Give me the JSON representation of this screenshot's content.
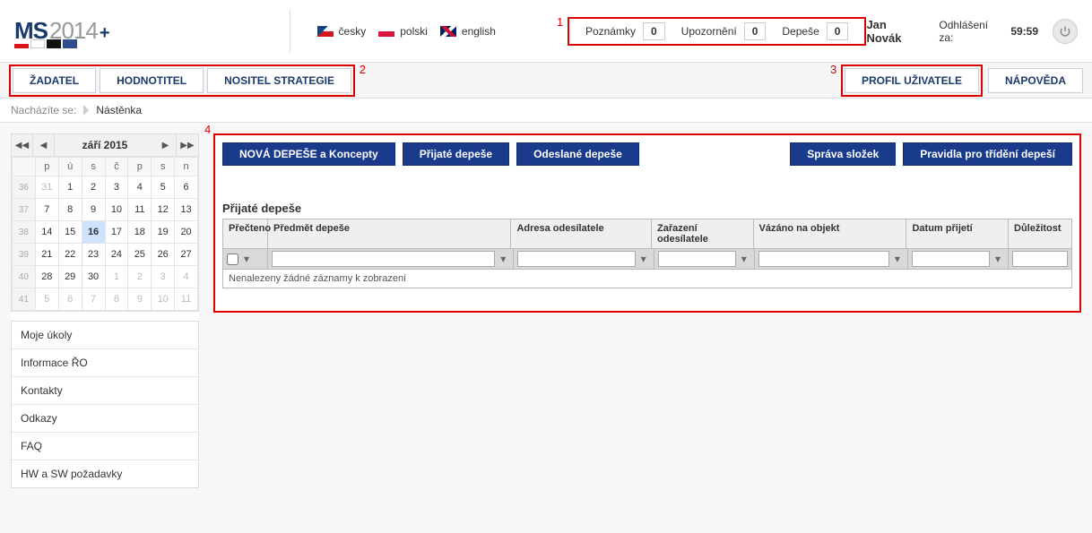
{
  "annotations": {
    "a1": "1",
    "a2": "2",
    "a3": "3",
    "a4": "4"
  },
  "topbar": {
    "logo_ms": "MS",
    "logo_year": "2014",
    "logo_plus": "+",
    "languages": {
      "cz": "česky",
      "pl": "polski",
      "en": "english"
    },
    "counters": {
      "notes_label": "Poznámky",
      "notes_value": "0",
      "alerts_label": "Upozornění",
      "alerts_value": "0",
      "msgs_label": "Depeše",
      "msgs_value": "0"
    },
    "username": "Jan Novák",
    "logout_label": "Odhlášení za:",
    "logout_time": "59:59"
  },
  "menubar": {
    "left": {
      "zadatel": "ŽADATEL",
      "hodnotitel": "HODNOTITEL",
      "nositel": "NOSITEL STRATEGIE"
    },
    "right": {
      "profile": "PROFIL UŽIVATELE",
      "help": "NÁPOVĚDA"
    }
  },
  "breadcrumb": {
    "prefix": "Nacházíte se:",
    "current": "Nástěnka"
  },
  "calendar": {
    "title": "září 2015",
    "days": [
      "p",
      "ú",
      "s",
      "č",
      "p",
      "s",
      "n"
    ],
    "weeks": [
      {
        "wn": "36",
        "d": [
          "31",
          "1",
          "2",
          "3",
          "4",
          "5",
          "6"
        ],
        "other": [
          true,
          false,
          false,
          false,
          false,
          false,
          false
        ]
      },
      {
        "wn": "37",
        "d": [
          "7",
          "8",
          "9",
          "10",
          "11",
          "12",
          "13"
        ],
        "other": [
          false,
          false,
          false,
          false,
          false,
          false,
          false
        ]
      },
      {
        "wn": "38",
        "d": [
          "14",
          "15",
          "16",
          "17",
          "18",
          "19",
          "20"
        ],
        "other": [
          false,
          false,
          false,
          false,
          false,
          false,
          false
        ],
        "today": 2
      },
      {
        "wn": "39",
        "d": [
          "21",
          "22",
          "23",
          "24",
          "25",
          "26",
          "27"
        ],
        "other": [
          false,
          false,
          false,
          false,
          false,
          false,
          false
        ]
      },
      {
        "wn": "40",
        "d": [
          "28",
          "29",
          "30",
          "1",
          "2",
          "3",
          "4"
        ],
        "other": [
          false,
          false,
          false,
          true,
          true,
          true,
          true
        ]
      },
      {
        "wn": "41",
        "d": [
          "5",
          "6",
          "7",
          "8",
          "9",
          "10",
          "11"
        ],
        "other": [
          true,
          true,
          true,
          true,
          true,
          true,
          true
        ]
      }
    ]
  },
  "side_links": [
    "Moje úkoly",
    "Informace ŘO",
    "Kontakty",
    "Odkazy",
    "FAQ",
    "HW a SW požadavky"
  ],
  "main": {
    "buttons": {
      "new": "NOVÁ DEPEŠE a Koncepty",
      "received": "Přijaté depeše",
      "sent": "Odeslané depeše",
      "folders": "Správa složek",
      "rules": "Pravidla pro třídění depeší"
    },
    "section_title": "Přijaté depeše",
    "columns": {
      "read": "Přečteno",
      "subject": "Předmět depeše",
      "sender_addr": "Adresa odesílatele",
      "sender_cat": "Zařazení odesílatele",
      "bound": "Vázáno na objekt",
      "date": "Datum přijetí",
      "importance": "Důležitost"
    },
    "empty_msg": "Nenalezeny žádné záznamy k zobrazení"
  }
}
